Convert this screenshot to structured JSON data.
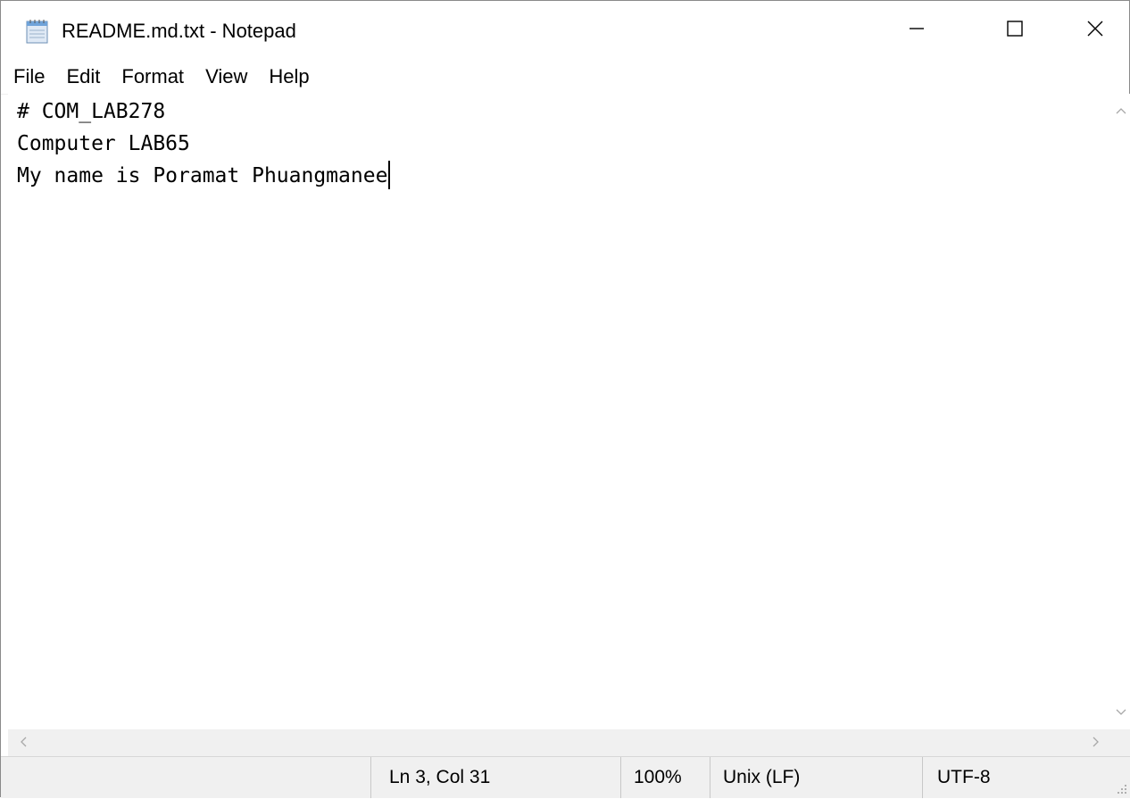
{
  "window": {
    "title": "README.md.txt - Notepad",
    "app_icon": "notepad-icon",
    "controls": {
      "minimize_icon": "minimize-icon",
      "maximize_icon": "maximize-icon",
      "close_icon": "close-icon"
    }
  },
  "menu": {
    "items": [
      {
        "label": "File"
      },
      {
        "label": "Edit"
      },
      {
        "label": "Format"
      },
      {
        "label": "View"
      },
      {
        "label": "Help"
      }
    ]
  },
  "editor": {
    "lines": [
      "# COM_LAB278",
      "Computer LAB65",
      "My name is Poramat Phuangmanee"
    ]
  },
  "statusbar": {
    "position": "Ln 3, Col 31",
    "zoom": "100%",
    "line_ending": "Unix (LF)",
    "encoding": "UTF-8"
  }
}
